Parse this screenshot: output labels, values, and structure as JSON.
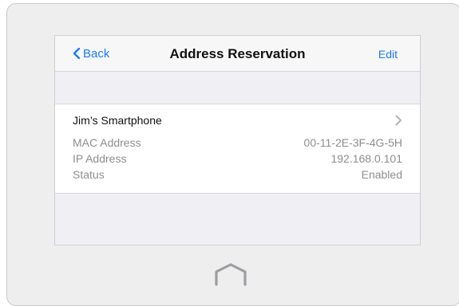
{
  "navbar": {
    "back_label": "Back",
    "title": "Address Reservation",
    "edit_label": "Edit"
  },
  "reservation": {
    "device_name": "Jim’s Smartphone",
    "fields": [
      {
        "label": "MAC Address",
        "value": "00-11-2E-3F-4G-5H"
      },
      {
        "label": "IP Address",
        "value": "192.168.0.101"
      },
      {
        "label": "Status",
        "value": "Enabled"
      }
    ]
  },
  "colors": {
    "accent": "#1a7cf5",
    "muted_text": "#8e8e93",
    "background": "#efeff4"
  },
  "icons": {
    "back": "chevron-left-icon",
    "disclosure": "chevron-right-icon",
    "home": "home-button-icon"
  }
}
